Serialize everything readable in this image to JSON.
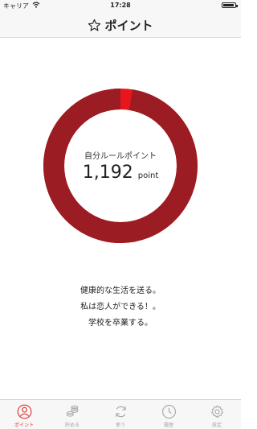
{
  "status_bar": {
    "carrier": "キャリア",
    "time": "17:28",
    "battery_level": 0.95
  },
  "nav": {
    "title": "ポイント",
    "icon": "star-outline-icon"
  },
  "summary": {
    "label": "自分ルールポイント",
    "value": "1,192",
    "unit": "point",
    "ring_filled_fraction": 0.975,
    "colors": {
      "main": "#9b1c23",
      "accent": "#e8161c"
    }
  },
  "goals": [
    "健康的な生活を送る。",
    "私は恋人ができる！。",
    "学校を卒業する。"
  ],
  "tabs": [
    {
      "label": "ポイント",
      "icon": "person-icon",
      "active": true
    },
    {
      "label": "貯める",
      "icon": "coins-icon",
      "active": false
    },
    {
      "label": "使う",
      "icon": "refresh-icon",
      "active": false
    },
    {
      "label": "履歴",
      "icon": "clock-icon",
      "active": false
    },
    {
      "label": "設定",
      "icon": "gear-icon",
      "active": false
    }
  ],
  "colors": {
    "active_tab": "#e0302a",
    "inactive_tab": "#a5a5a5",
    "bar_background": "#f7f7f7"
  }
}
